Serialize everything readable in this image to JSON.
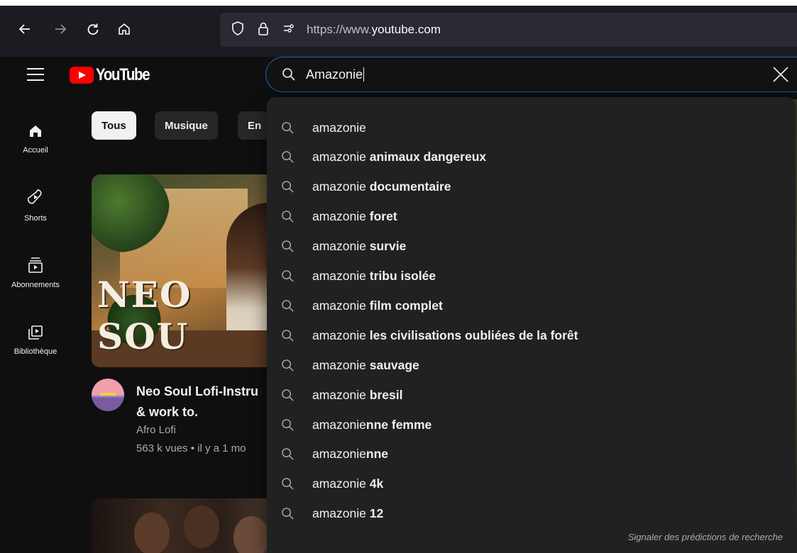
{
  "browser": {
    "url_prefix": "https://www.",
    "url_domain": "youtube.com",
    "icons": [
      "back-arrow-icon",
      "forward-arrow-icon",
      "reload-icon",
      "home-icon",
      "shield-icon",
      "lock-icon",
      "permissions-icon"
    ]
  },
  "header": {
    "logo_text": "YouTube",
    "search_value": "Amazonie"
  },
  "sidebar": {
    "items": [
      {
        "label": "Accueil",
        "icon": "home-icon"
      },
      {
        "label": "Shorts",
        "icon": "shorts-icon"
      },
      {
        "label": "Abonnements",
        "icon": "subscriptions-icon"
      },
      {
        "label": "Bibliothèque",
        "icon": "library-icon"
      }
    ]
  },
  "chips": [
    "Tous",
    "Musique",
    "En"
  ],
  "video": {
    "thumbnail_text": "NEO SOU",
    "title_line1": "Neo Soul Lofi-Instru",
    "title_line2": "& work to.",
    "channel": "Afro Lofi",
    "meta": "563 k vues • il y a 1 mo"
  },
  "suggestions": [
    {
      "base": "amazonie",
      "bold": ""
    },
    {
      "base": "amazonie ",
      "bold": "animaux dangereux"
    },
    {
      "base": "amazonie ",
      "bold": "documentaire"
    },
    {
      "base": "amazonie ",
      "bold": "foret"
    },
    {
      "base": "amazonie ",
      "bold": "survie"
    },
    {
      "base": "amazonie ",
      "bold": "tribu isolée"
    },
    {
      "base": "amazonie ",
      "bold": "film complet"
    },
    {
      "base": "amazonie ",
      "bold": "les civilisations oubliées de la forêt"
    },
    {
      "base": "amazonie ",
      "bold": "sauvage"
    },
    {
      "base": "amazonie ",
      "bold": "bresil"
    },
    {
      "base": "amazonie",
      "bold": "nne femme"
    },
    {
      "base": "amazonie",
      "bold": "nne"
    },
    {
      "base": "amazonie ",
      "bold": "4k"
    },
    {
      "base": "amazonie ",
      "bold": "12"
    }
  ],
  "report_link": "Signaler des prédictions de recherche",
  "colors": {
    "background": "#0f0f0f",
    "dropdown": "#212121",
    "search_focus": "#1c62b9",
    "brand_red": "#ff0000"
  }
}
